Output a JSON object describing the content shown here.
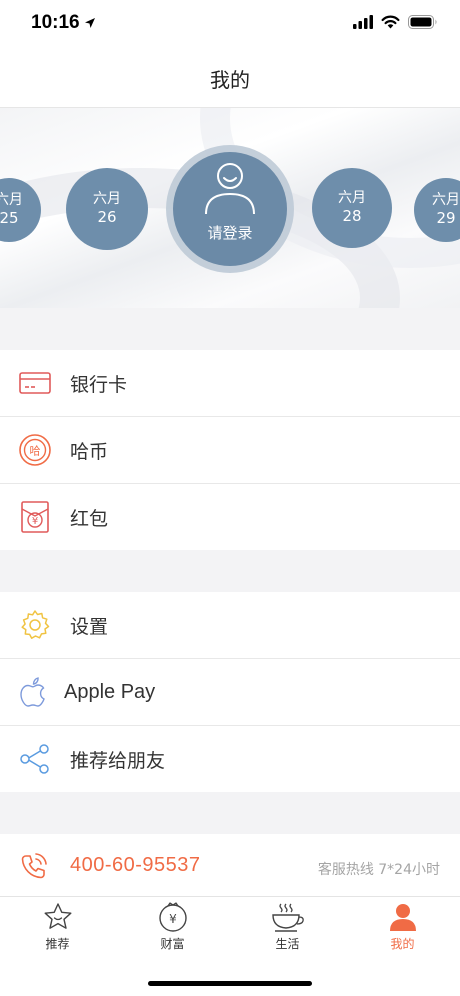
{
  "status_bar": {
    "time": "10:16"
  },
  "nav": {
    "title": "我的"
  },
  "banner": {
    "dates": [
      {
        "month": "六月",
        "day": "25"
      },
      {
        "month": "六月",
        "day": "26"
      },
      {
        "month": "六月",
        "day": "28"
      },
      {
        "month": "六月",
        "day": "29"
      }
    ],
    "login_label": "请登录"
  },
  "menu_group_1": [
    {
      "label": "银行卡",
      "icon": "bank-card-icon"
    },
    {
      "label": "哈币",
      "icon": "ha-coin-icon"
    },
    {
      "label": "红包",
      "icon": "red-envelope-icon"
    }
  ],
  "menu_group_2": [
    {
      "label": "设置",
      "icon": "gear-icon"
    },
    {
      "label": "Apple Pay",
      "icon": "apple-icon"
    },
    {
      "label": "推荐给朋友",
      "icon": "share-icon"
    }
  ],
  "hotline": {
    "number": "400-60-95537",
    "note": "客服热线 7*24小时"
  },
  "tabs": [
    {
      "label": "推荐",
      "icon": "star-icon",
      "active": false
    },
    {
      "label": "财富",
      "icon": "money-bag-icon",
      "active": false
    },
    {
      "label": "生活",
      "icon": "teacup-icon",
      "active": false
    },
    {
      "label": "我的",
      "icon": "person-icon",
      "active": true
    }
  ],
  "colors": {
    "accent": "#f06b45",
    "date_circle": "#6e8eab",
    "login_circle": "#6b8aa7"
  }
}
